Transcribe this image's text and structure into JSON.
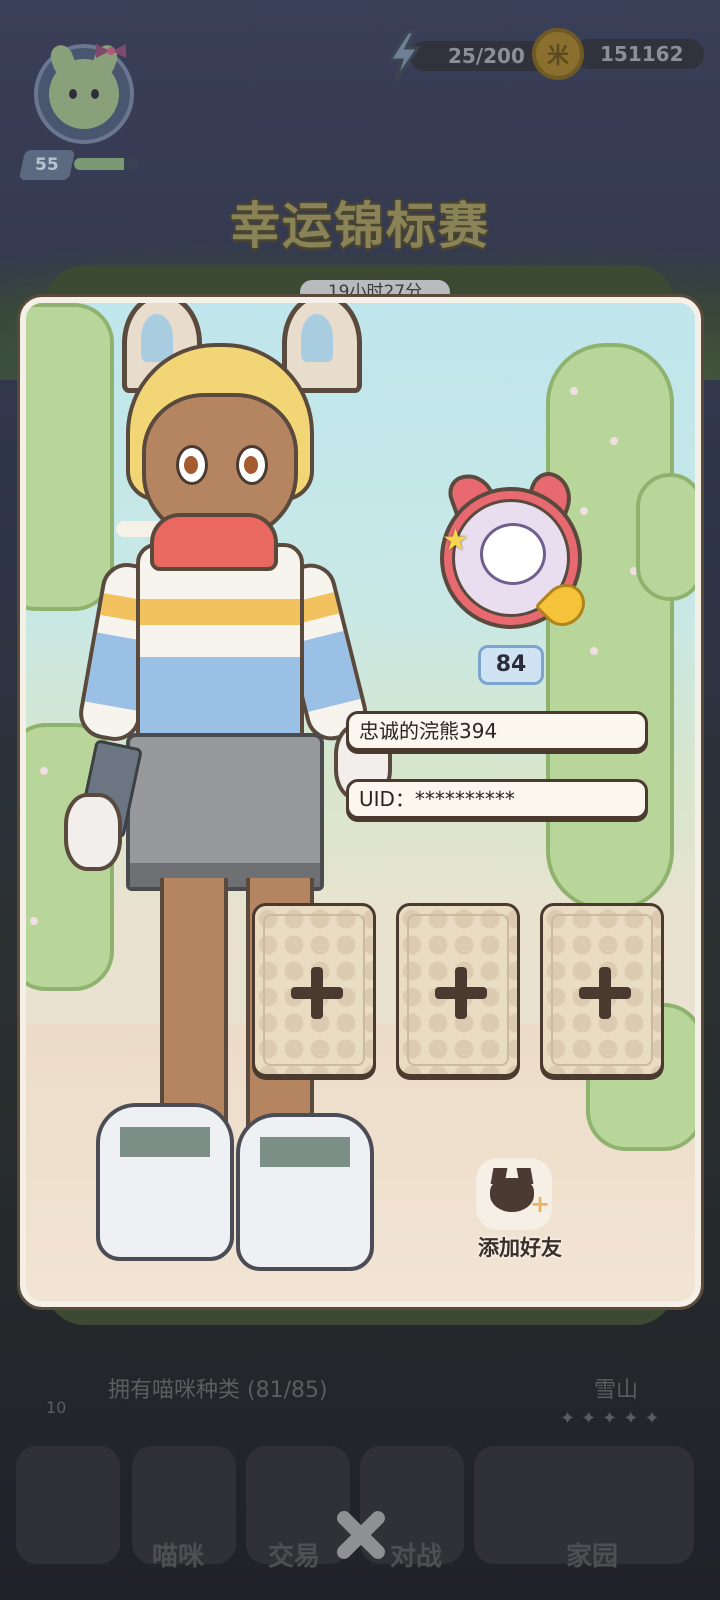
{
  "header": {
    "player_level": "55",
    "xp_fraction": 0.75,
    "energy": "25/200",
    "coins": "151162",
    "coin_symbol": "米"
  },
  "event": {
    "title": "幸运锦标赛",
    "timer": "19小时27分"
  },
  "background_panel": {
    "collection_text": "拥有喵咪种类 (81/85)",
    "collection_level": "10",
    "location": "雪山",
    "stars": "✦✦✦✦✦"
  },
  "bottom_nav": {
    "items": [
      {
        "label": ""
      },
      {
        "label": "喵咪"
      },
      {
        "label": "交易"
      },
      {
        "label": "对战"
      },
      {
        "label": "家园"
      }
    ]
  },
  "profile_card": {
    "level": "84",
    "nickname": "忠诚的浣熊394",
    "uid": "UID：**********",
    "add_friend_label": "添加好友",
    "slot_count": 3
  },
  "colors": {
    "card_border": "#f4efe7",
    "outline": "#4a3a30",
    "level_pill": "#cfe3f3"
  }
}
